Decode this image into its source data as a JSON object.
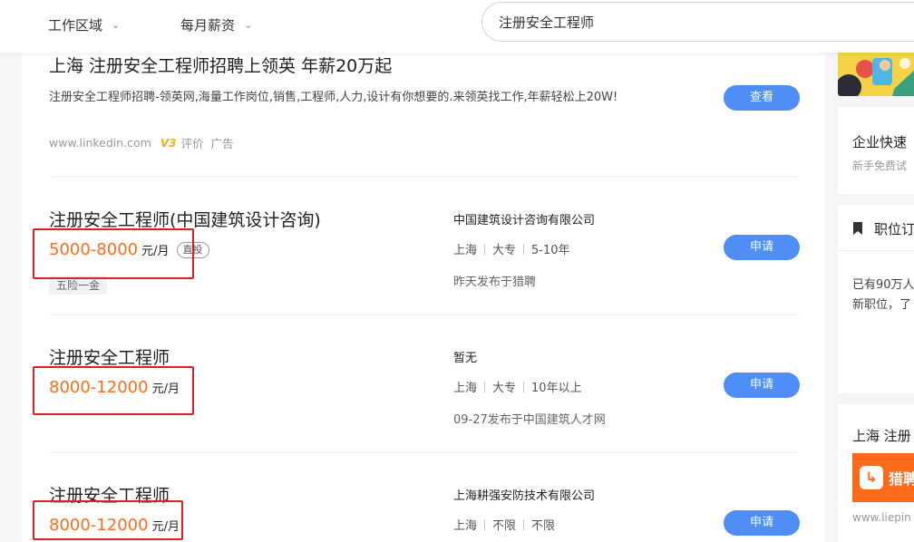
{
  "filters": {
    "area": "工作区域",
    "salary": "每月薪资"
  },
  "search": {
    "value": "注册安全工程师"
  },
  "ad": {
    "title": "上海 注册安全工程师招聘上领英 年薪20万起",
    "description": "注册安全工程师招聘-领英网,海量工作岗位,销售,工程师,人力,设计有你想要的.来领英找工作,年薪轻松上20W!",
    "domain": "www.linkedin.com",
    "badge": "V3",
    "rating": "评价",
    "ad_label": "广告",
    "button": "查看"
  },
  "jobs": [
    {
      "title": "注册安全工程师(中国建筑设计咨询)",
      "salary": "5000-8000",
      "unit": "元/月",
      "direct": "直投",
      "tag": "五险一金",
      "company": "中国建筑设计咨询有限公司",
      "city": "上海",
      "education": "大专",
      "experience": "5-10年",
      "posted": "昨天发布于猎聘",
      "button": "申请"
    },
    {
      "title": "注册安全工程师",
      "salary": "8000-12000",
      "unit": "元/月",
      "company": "暂无",
      "city": "上海",
      "education": "大专",
      "experience": "10年以上",
      "posted": "09-27发布于中国建筑人才网",
      "button": "申请"
    },
    {
      "title": "注册安全工程师",
      "salary": "8000-12000",
      "unit": "元/月",
      "company": "上海耕强安防技术有限公司",
      "city": "上海",
      "education": "不限",
      "experience": "不限",
      "button": "申请"
    }
  ],
  "sidebar": {
    "enterprise_title": "企业快速",
    "enterprise_sub": "新手免费试",
    "subscribe_title": "职位订",
    "subscribe_line1": "已有90万人",
    "subscribe_line2": "新职位，了",
    "liepin_title": "上海 注册",
    "liepin_logo_text": "猎聘",
    "liepin_domain": "www.liepin"
  },
  "colors": {
    "salary": "#ff6b1a",
    "button": "#4e8ef6",
    "highlight_box": "#e02020"
  }
}
